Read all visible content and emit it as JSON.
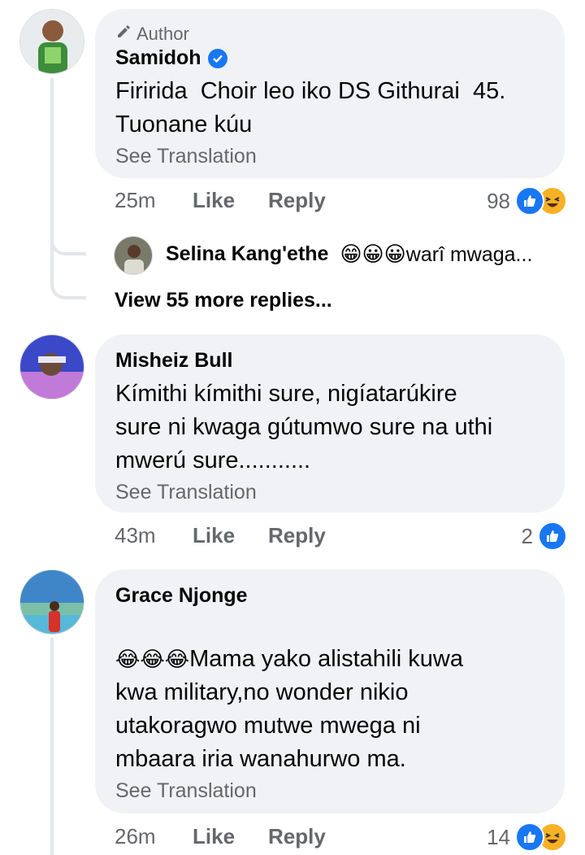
{
  "comments": [
    {
      "author_tag": "Author",
      "name": "Samidoh",
      "verified": true,
      "text": "Firirida  Choir leo iko DS Githurai  45.\nTuonane kúu",
      "see_translation": "See Translation",
      "time": "25m",
      "like_label": "Like",
      "reply_label": "Reply",
      "reaction_count": "98",
      "reactions": [
        "like-icon",
        "haha-icon"
      ],
      "avatar_colors": [
        "#3d8d3a",
        "#8fd46b"
      ]
    },
    {
      "name": "Misheiz Bull",
      "text": "Kímithi kímithi sure, nigíatarúkire\nsure ni kwaga gútumwo sure na uthi\nmwerú sure...........",
      "see_translation": "See Translation",
      "time": "43m",
      "like_label": "Like",
      "reply_label": "Reply",
      "reaction_count": "2",
      "reactions": [
        "like-icon"
      ],
      "avatar_colors": [
        "#3b49c9",
        "#c27ad8"
      ]
    },
    {
      "name": "Grace Njonge",
      "emojis": "😂😂😂",
      "text": "Mama yako alistahili kuwa\nkwa military,no wonder nikio\nutakoragwo mutwe mwega ni\nmbaara iria wanahurwo ma.",
      "see_translation": "See Translation",
      "time": "26m",
      "like_label": "Like",
      "reply_label": "Reply",
      "reaction_count": "14",
      "reactions": [
        "like-icon",
        "haha-icon"
      ],
      "avatar_colors": [
        "#3f86c9",
        "#7ac0a8"
      ]
    }
  ],
  "reply_preview": {
    "name": "Selina Kang'ethe",
    "emojis": "😁😀😀",
    "text": "warî mwaga...",
    "avatar_colors": [
      "#7a7a6a",
      "#dcdcd2"
    ]
  },
  "view_more": "View 55 more replies...",
  "colors": {
    "bubble": "#f0f2f5",
    "secondary_text": "#65676b",
    "accent": "#1877f2",
    "haha": "#f7b125"
  }
}
